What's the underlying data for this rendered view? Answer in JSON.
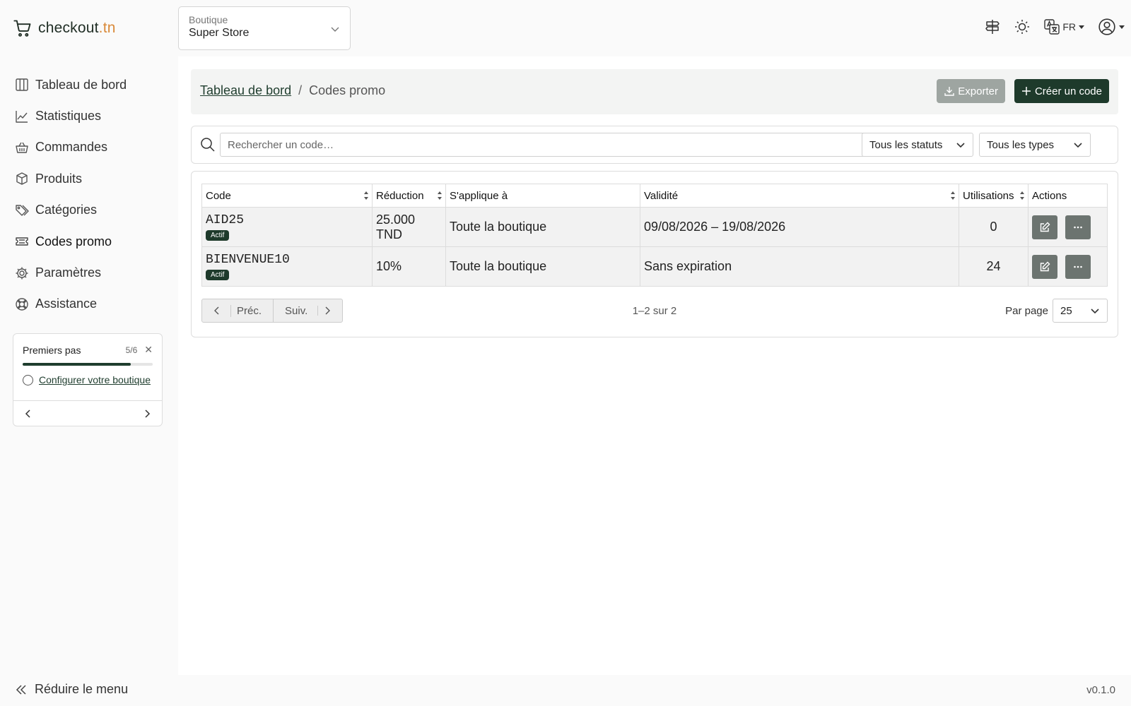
{
  "app": {
    "logo_name": "checkout",
    "logo_tld": ".tn",
    "version": "v0.1.0"
  },
  "store_selector": {
    "label": "Boutique",
    "value": "Super Store"
  },
  "topbar": {
    "language": "FR"
  },
  "sidebar": {
    "items": [
      {
        "label": "Tableau de bord",
        "icon": "columns-icon"
      },
      {
        "label": "Statistiques",
        "icon": "chart-line-icon"
      },
      {
        "label": "Commandes",
        "icon": "basket-icon"
      },
      {
        "label": "Produits",
        "icon": "box-icon"
      },
      {
        "label": "Catégories",
        "icon": "tags-icon"
      },
      {
        "label": "Codes promo",
        "icon": "ticket-icon",
        "active": true
      },
      {
        "label": "Paramètres",
        "icon": "gear-icon"
      },
      {
        "label": "Assistance",
        "icon": "lifebuoy-icon"
      }
    ],
    "collapse_label": "Réduire le menu"
  },
  "onboarding": {
    "title": "Premiers pas",
    "count": "5/6",
    "progress": 0.833,
    "step_label": "Configurer votre boutique"
  },
  "breadcrumb": {
    "parent": "Tableau de bord",
    "separator": "/",
    "current": "Codes promo"
  },
  "actions": {
    "export_label": "Exporter",
    "create_label": "Créer un code"
  },
  "filters": {
    "search_placeholder": "Rechercher un code…",
    "status_value": "Tous les statuts",
    "type_value": "Tous les types"
  },
  "table": {
    "headers": {
      "code": "Code",
      "reduction": "Réduction",
      "applies": "S'applique à",
      "validity": "Validité",
      "uses": "Utilisations",
      "actions": "Actions"
    },
    "rows": [
      {
        "code": "AID25",
        "status": "Actif",
        "reduction": "25.000 TND",
        "applies": "Toute la boutique",
        "validity": "09/08/2026 – 19/08/2026",
        "uses": "0"
      },
      {
        "code": "BIENVENUE10",
        "status": "Actif",
        "reduction": "10%",
        "applies": "Toute la boutique",
        "validity": "Sans expiration",
        "uses": "24"
      }
    ]
  },
  "pagination": {
    "prev_label": "Préc.",
    "next_label": "Suiv.",
    "range": "1–2 sur 2",
    "per_page_label": "Par page",
    "per_page_value": "25"
  },
  "colors": {
    "accent": "#1e3a2b",
    "logo_tld": "#d98a3a",
    "export_button": "#9ea5a1",
    "action_button": "#6c7470"
  }
}
